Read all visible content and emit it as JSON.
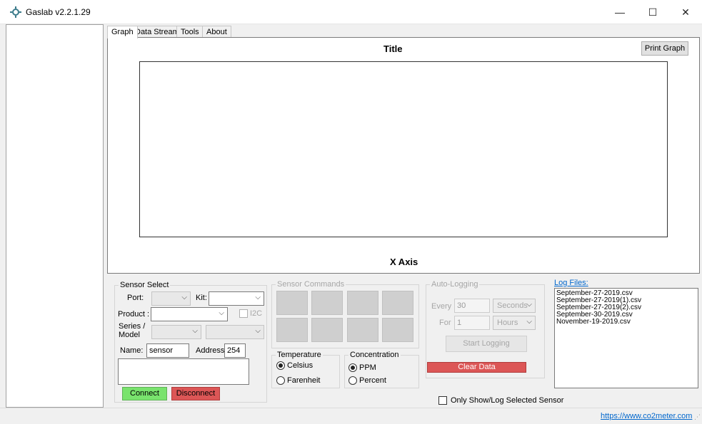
{
  "window": {
    "title": "Gaslab v2.2.1.29",
    "minimize": "—",
    "maximize": "☐",
    "close": "✕"
  },
  "tabs": [
    {
      "label": "Graph",
      "active": true
    },
    {
      "label": "Data Stream",
      "active": false
    },
    {
      "label": "Tools",
      "active": false
    },
    {
      "label": "About",
      "active": false
    }
  ],
  "graph": {
    "title": "Title",
    "xlabel": "X Axis",
    "print_button": "Print Graph"
  },
  "sensor_select": {
    "title": "Sensor Select",
    "port_label": "Port:",
    "kit_label": "Kit:",
    "product_label": "Product :",
    "i2c_label": "I2C",
    "series_label_1": "Series /",
    "series_label_2": "Model",
    "name_label": "Name:",
    "name_value": "sensor",
    "address_label": "Address:",
    "address_value": "254",
    "connect": "Connect",
    "disconnect": "Disconnect"
  },
  "sensor_commands": {
    "title": "Sensor Commands"
  },
  "temperature": {
    "title": "Temperature",
    "options": [
      "Celsius",
      "Farenheit"
    ],
    "selected": "Celsius"
  },
  "concentration": {
    "title": "Concentration",
    "options": [
      "PPM",
      "Percent"
    ],
    "selected": "PPM"
  },
  "auto_logging": {
    "title": "Auto-Logging",
    "every_label": "Every",
    "every_value": "30",
    "every_unit": "Seconds",
    "for_label": "For",
    "for_value": "1",
    "for_unit": "Hours",
    "start_button": "Start Logging",
    "clear_button": "Clear Data"
  },
  "log_files": {
    "title": "Log Files:",
    "files": [
      "September-27-2019.csv",
      "September-27-2019(1).csv",
      "September-27-2019(2).csv",
      "September-30-2019.csv",
      "November-19-2019.csv"
    ]
  },
  "only_show_label": "Only Show/Log Selected Sensor",
  "status": {
    "link": "https://www.co2meter.com"
  }
}
